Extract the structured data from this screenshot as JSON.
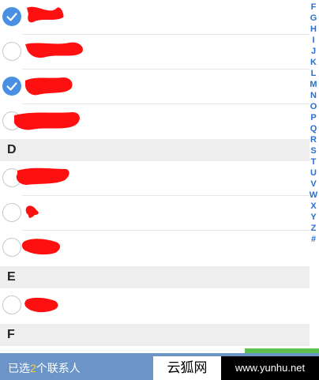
{
  "contacts": [
    {
      "name": "",
      "checked": true
    },
    {
      "name": "",
      "checked": false
    },
    {
      "name": "",
      "checked": true
    },
    {
      "name": "",
      "checked": false
    }
  ],
  "sections": {
    "d": {
      "header": "D",
      "contacts": [
        {
          "name": ""
        },
        {
          "name": ""
        },
        {
          "name": ""
        }
      ]
    },
    "e": {
      "header": "E",
      "contacts": [
        {
          "name": ""
        }
      ]
    },
    "f": {
      "header": "F"
    }
  },
  "index_letters": [
    "F",
    "G",
    "H",
    "I",
    "J",
    "K",
    "L",
    "M",
    "N",
    "O",
    "P",
    "Q",
    "R",
    "S",
    "T",
    "U",
    "V",
    "W",
    "X",
    "Y",
    "Z",
    "#"
  ],
  "footer": {
    "selected_prefix": "已选",
    "selected_count": "2",
    "selected_suffix": "个联系人"
  },
  "watermark": {
    "site_name": "云狐网",
    "url": "www.yunhu.net"
  },
  "colors": {
    "accent_blue": "#4a90e2",
    "index_blue": "#2c6fd0",
    "footer_bar": "#6b95c9",
    "count_highlight": "#ffcf33",
    "redaction_red": "#ff0000"
  }
}
